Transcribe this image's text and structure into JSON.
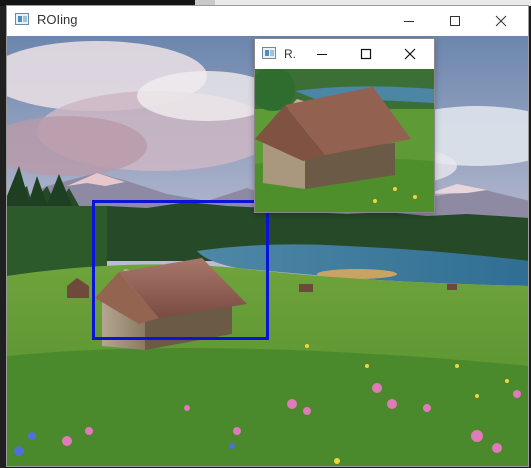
{
  "main_window": {
    "title": "ROIing",
    "icon": "app-window-icon",
    "controls": [
      "minimize-icon",
      "maximize-icon",
      "close-icon"
    ]
  },
  "roi_window": {
    "title": "R.",
    "icon": "app-window-icon",
    "controls": [
      "minimize-icon",
      "maximize-icon",
      "close-icon"
    ]
  },
  "image": {
    "description_icon": "landscape-photo"
  },
  "colors": {
    "roi_box": "#0a14d8",
    "titlebar": "#ffffff"
  }
}
